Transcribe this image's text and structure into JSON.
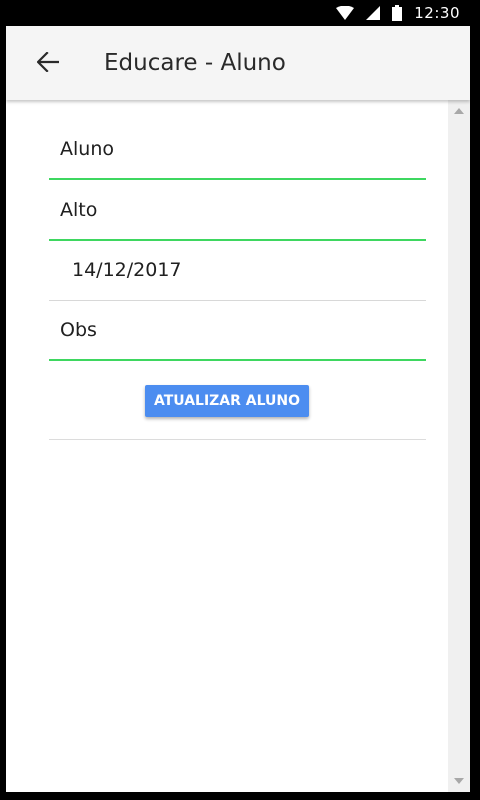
{
  "status_bar": {
    "time": "12:30",
    "icons": [
      "wifi-icon",
      "signal-icon",
      "battery-icon"
    ]
  },
  "toolbar": {
    "back_icon": "arrow-back-icon",
    "title": "Educare - Aluno"
  },
  "form": {
    "fields": [
      {
        "value": "Aluno",
        "state": "focused-underline"
      },
      {
        "value": "Alto",
        "state": "focused-underline"
      },
      {
        "value": "14/12/2017",
        "state": "plain"
      },
      {
        "value": "Obs",
        "state": "focused-underline"
      }
    ],
    "update_button": "ATUALIZAR ALUNO"
  },
  "colors": {
    "accent_underline": "#3ed760",
    "button": "#4c8df0",
    "toolbar_bg": "#f5f5f5"
  }
}
